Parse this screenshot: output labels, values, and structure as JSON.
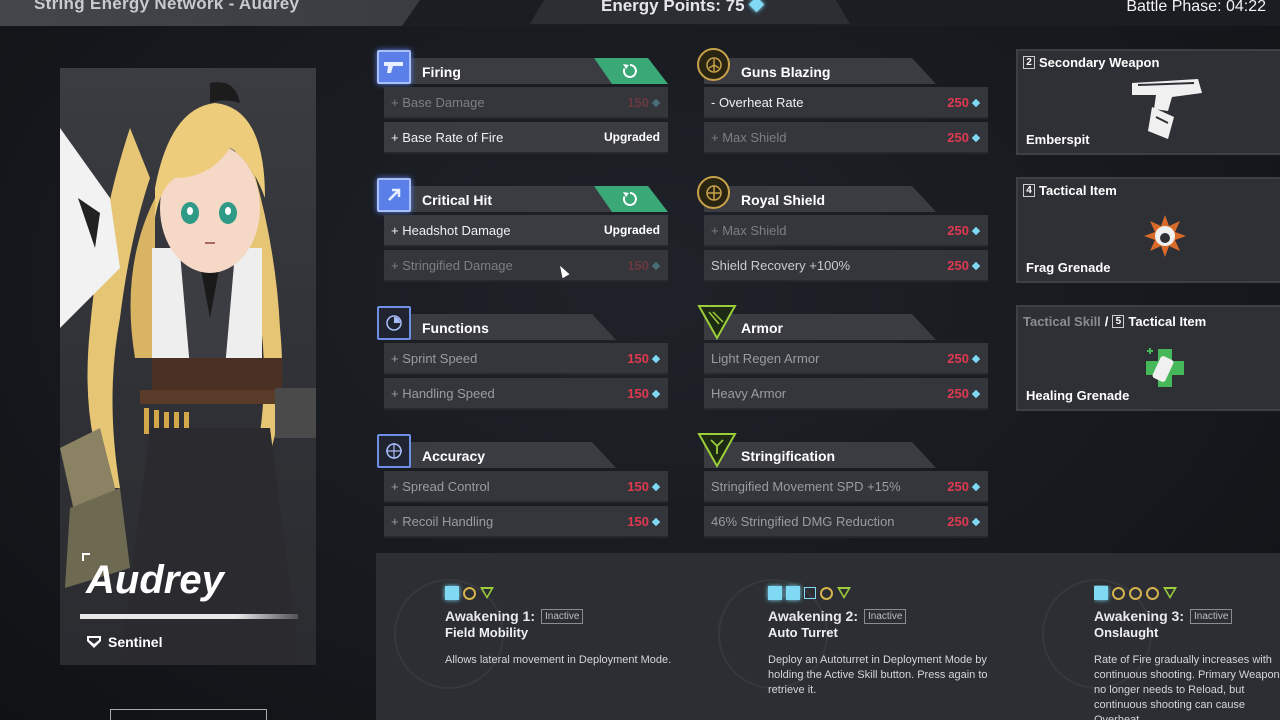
{
  "header": {
    "title": "String Energy Network - Audrey",
    "energy_label": "Energy Points: 75",
    "battle_phase": "Battle Phase: 04:22"
  },
  "character": {
    "name": "Audrey",
    "class_name": "Sentinel"
  },
  "left_groups": [
    {
      "name": "Firing",
      "icon": "pistol-icon",
      "rows": [
        {
          "label": "+ Base Damage",
          "cost": "150",
          "state": "dim"
        },
        {
          "label": "+ Base Rate of Fire",
          "status": "Upgraded",
          "state": "upgraded"
        }
      ]
    },
    {
      "name": "Critical Hit",
      "icon": "arrow-icon",
      "rows": [
        {
          "label": "+ Headshot Damage",
          "status": "Upgraded",
          "state": "upgraded"
        },
        {
          "label": "+ Stringified Damage",
          "cost": "150",
          "state": "dim"
        }
      ]
    },
    {
      "name": "Functions",
      "icon": "pie-icon",
      "rows": [
        {
          "label": "+ Sprint Speed",
          "cost": "150",
          "state": "dim"
        },
        {
          "label": "+ Handling Speed",
          "cost": "150",
          "state": "dim"
        }
      ]
    },
    {
      "name": "Accuracy",
      "icon": "crosshair-icon",
      "rows": [
        {
          "label": "+ Spread Control",
          "cost": "150",
          "state": "dim"
        },
        {
          "label": "+ Recoil Handling",
          "cost": "150",
          "state": "dim"
        }
      ]
    }
  ],
  "right_groups": [
    {
      "name": "Guns Blazing",
      "icon": "flame-icon",
      "rows": [
        {
          "label": "- Overheat Rate",
          "cost": "250",
          "state": "normal"
        },
        {
          "label": "+ Max Shield",
          "cost": "250",
          "state": "dim"
        }
      ]
    },
    {
      "name": "Royal Shield",
      "icon": "shield-icon",
      "rows": [
        {
          "label": "+ Max Shield",
          "cost": "250",
          "state": "dim"
        },
        {
          "label": "Shield Recovery +100%",
          "cost": "250",
          "state": "normal"
        }
      ]
    },
    {
      "name": "Armor",
      "icon": "armor-icon",
      "rows": [
        {
          "label": "Light Regen Armor",
          "cost": "250",
          "state": "dim"
        },
        {
          "label": "Heavy Armor",
          "cost": "250",
          "state": "dim"
        }
      ]
    },
    {
      "name": "Stringification",
      "icon": "fork-icon",
      "rows": [
        {
          "label": "Stringified Movement SPD +15%",
          "cost": "250",
          "state": "dim"
        },
        {
          "label": "46% Stringified DMG Reduction",
          "cost": "250",
          "state": "dim"
        }
      ]
    }
  ],
  "loadout": [
    {
      "prefix": "",
      "key": "2",
      "title": "Secondary Weapon",
      "item": "Emberspit",
      "icon": "pistol-icon"
    },
    {
      "prefix": "",
      "key": "4",
      "title": "Tactical Item",
      "item": "Frag Grenade",
      "icon": "grenade-icon"
    },
    {
      "prefix": "Tactical Skill",
      "separator": "/",
      "key": "5",
      "title": "Tactical Item",
      "item": "Healing Grenade",
      "icon": "healing-grenade-icon"
    }
  ],
  "awakenings": [
    {
      "title": "Awakening 1:",
      "status": "Inactive",
      "name": "Field Mobility",
      "desc": "Allows lateral movement in Deployment Mode."
    },
    {
      "title": "Awakening 2:",
      "status": "Inactive",
      "name": "Auto Turret",
      "desc": "Deploy an Autoturret in Deployment Mode by holding the Active Skill button. Press again to retrieve it."
    },
    {
      "title": "Awakening 3:",
      "status": "Inactive",
      "name": "Onslaught",
      "desc": "Rate of Fire gradually increases with continuous shooting. Primary Weapon no longer needs to Reload, but continuous shooting can cause Overheat."
    }
  ],
  "colors": {
    "cost_red": "#e0384f",
    "accent_blue": "#5b7fe8",
    "reset_green": "#3aa877",
    "gold": "#c7a24a",
    "lime": "#9ccd3a",
    "diamond": "#7fd9f2"
  }
}
